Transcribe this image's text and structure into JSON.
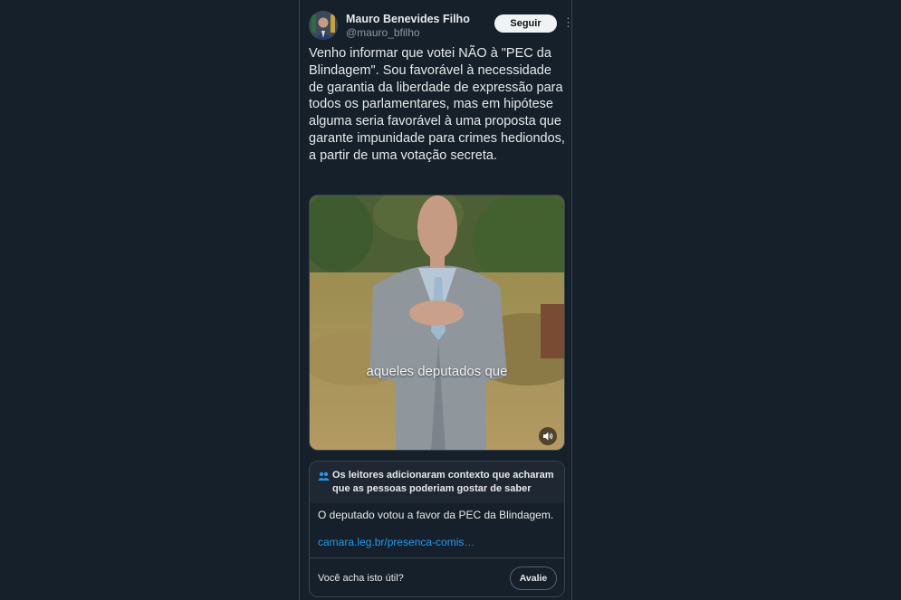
{
  "author": {
    "name": "Mauro Benevides Filho",
    "handle": "@mauro_bfilho",
    "follow_label": "Seguir",
    "more_icon": "more-dots-icon"
  },
  "tweet": {
    "text": "Venho informar que votei NÃO à \"PEC da Blindagem\". Sou favorável à necessidade de garantia da liberdade de expressão para todos os parlamentares, mas em hipótese alguma seria favorável à uma proposta que garante impunidade para crimes hediondos, a partir de uma votação secreta."
  },
  "video": {
    "caption": "aqueles deputados que",
    "volume_icon": "volume-icon"
  },
  "community_note": {
    "header": "Os leitores adicionaram contexto que acharam que as pessoas poderiam gostar de saber",
    "header_icon": "people-icon",
    "body": "O deputado votou a favor da PEC da Blindagem.",
    "link": "camara.leg.br/presenca-comis…",
    "question": "Você acha isto útil?",
    "rate_label": "Avalie"
  },
  "colors": {
    "background": "#15202b",
    "text": "#e7e9ea",
    "muted": "#8b98a5",
    "link": "#1d9bf0",
    "border": "#38444d"
  }
}
